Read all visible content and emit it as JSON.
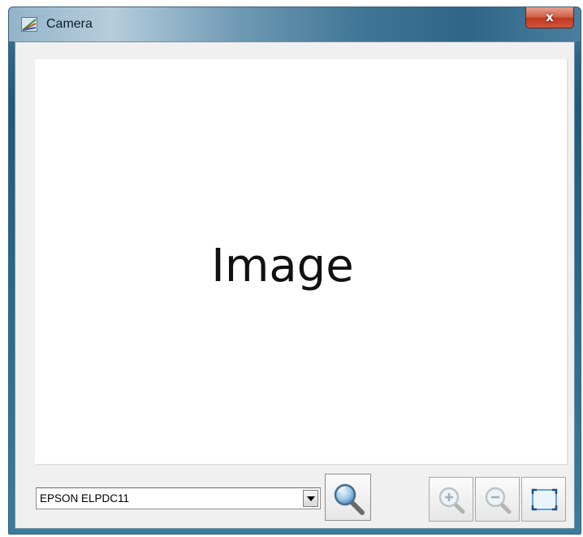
{
  "window": {
    "title": "Camera",
    "close_label": "x"
  },
  "preview": {
    "placeholder_text": "Image"
  },
  "camera_select": {
    "selected": "EPSON ELPDC11"
  },
  "toolbar": {
    "search_icon": "magnifier-icon",
    "zoom_in_icon": "zoom-in-icon",
    "zoom_out_icon": "zoom-out-icon",
    "fit_icon": "fit-to-window-icon"
  },
  "colors": {
    "titlebar_accent": "#2e6585",
    "close_button": "#c0391f",
    "client_background": "#f0f0f0"
  }
}
